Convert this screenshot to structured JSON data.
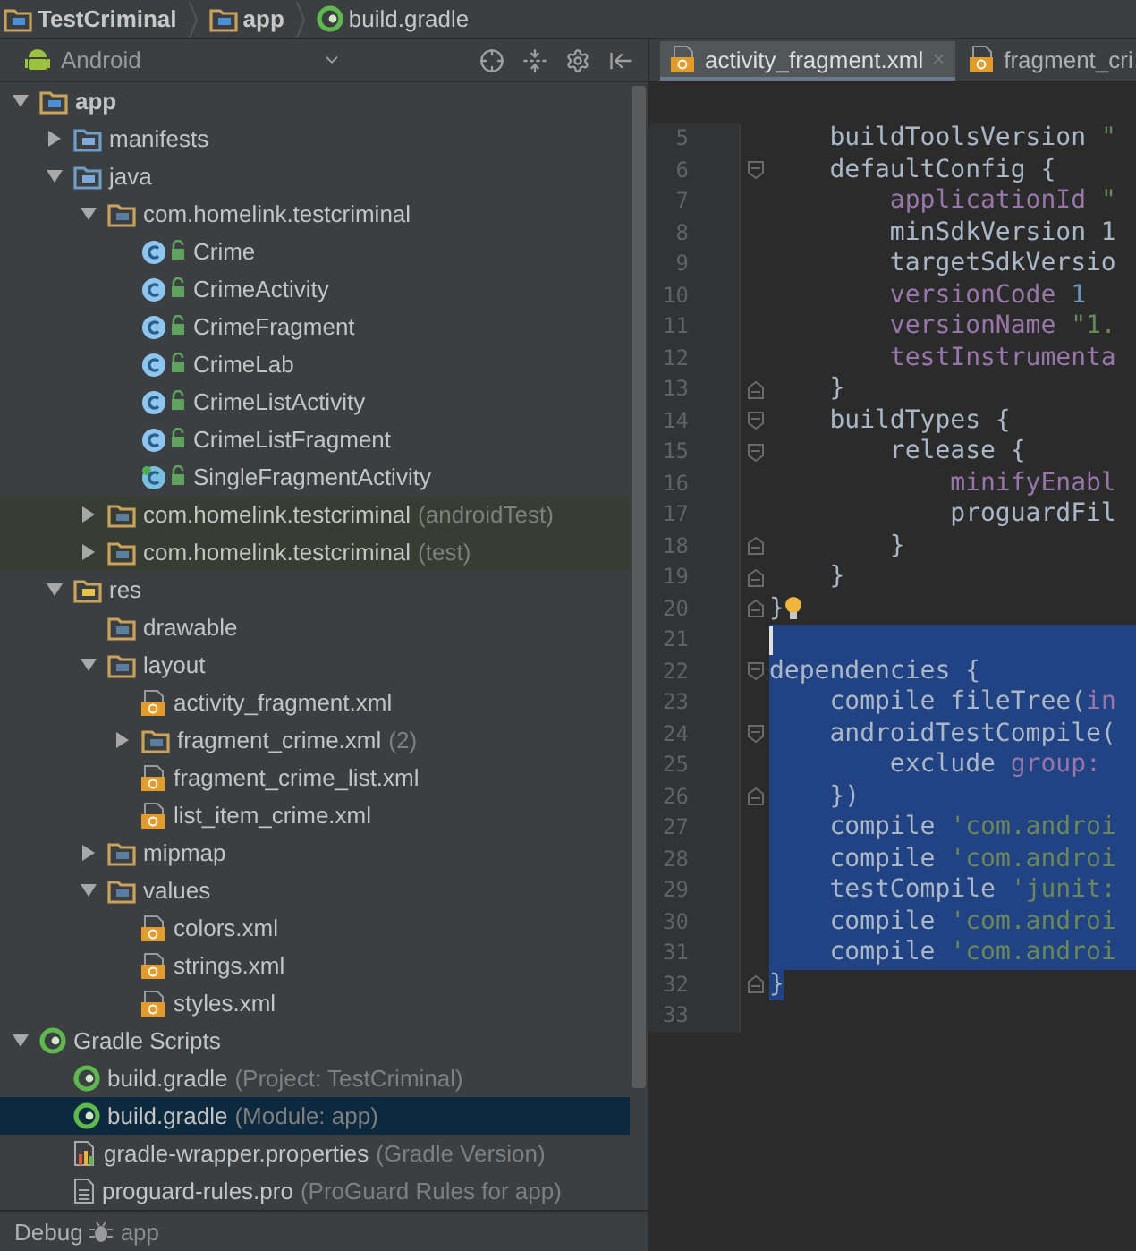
{
  "breadcrumb": [
    {
      "label": "TestCriminal",
      "kind": "project"
    },
    {
      "label": "app",
      "kind": "module"
    },
    {
      "label": "build.gradle",
      "kind": "gradle"
    }
  ],
  "project_panel": {
    "view": "Android"
  },
  "tree": {
    "items": [
      {
        "label": "app",
        "kind": "module",
        "expanded": true,
        "selected": false,
        "children": [
          {
            "label": "manifests",
            "kind": "folder",
            "expanded": false,
            "selected": false
          },
          {
            "label": "java",
            "kind": "folder",
            "expanded": true,
            "selected": false,
            "children": [
              {
                "label": "com.homelink.testcriminal",
                "kind": "package",
                "expanded": true,
                "selected": false,
                "children": [
                  {
                    "label": "Crime",
                    "kind": "class",
                    "selected": false
                  },
                  {
                    "label": "CrimeActivity",
                    "kind": "class",
                    "selected": false
                  },
                  {
                    "label": "CrimeFragment",
                    "kind": "class",
                    "selected": false
                  },
                  {
                    "label": "CrimeLab",
                    "kind": "class",
                    "selected": false
                  },
                  {
                    "label": "CrimeListActivity",
                    "kind": "class",
                    "selected": false
                  },
                  {
                    "label": "CrimeListFragment",
                    "kind": "class",
                    "selected": false
                  },
                  {
                    "label": "SingleFragmentActivity",
                    "kind": "abstract-class",
                    "selected": false
                  }
                ]
              },
              {
                "label": "com.homelink.testcriminal",
                "note": "(androidTest)",
                "kind": "package",
                "expanded": false,
                "test_scope": true,
                "selected": false
              },
              {
                "label": "com.homelink.testcriminal",
                "note": "(test)",
                "kind": "package",
                "expanded": false,
                "test_scope": true,
                "selected": false
              }
            ]
          },
          {
            "label": "res",
            "kind": "res-folder",
            "expanded": true,
            "selected": false,
            "children": [
              {
                "label": "drawable",
                "kind": "package",
                "selected": false
              },
              {
                "label": "layout",
                "kind": "package",
                "expanded": true,
                "selected": false,
                "children": [
                  {
                    "label": "activity_fragment.xml",
                    "kind": "xml",
                    "selected": false
                  },
                  {
                    "label": "fragment_crime.xml",
                    "note": "(2)",
                    "kind": "package",
                    "expanded": false,
                    "selected": false
                  },
                  {
                    "label": "fragment_crime_list.xml",
                    "kind": "xml",
                    "selected": false
                  },
                  {
                    "label": "list_item_crime.xml",
                    "kind": "xml",
                    "selected": false
                  }
                ]
              },
              {
                "label": "mipmap",
                "kind": "package",
                "expanded": false,
                "selected": false
              },
              {
                "label": "values",
                "kind": "package",
                "expanded": true,
                "selected": false,
                "children": [
                  {
                    "label": "colors.xml",
                    "kind": "xml",
                    "selected": false
                  },
                  {
                    "label": "strings.xml",
                    "kind": "xml",
                    "selected": false
                  },
                  {
                    "label": "styles.xml",
                    "kind": "xml",
                    "selected": false
                  }
                ]
              }
            ]
          }
        ]
      },
      {
        "label": "Gradle Scripts",
        "kind": "gradle",
        "expanded": true,
        "selected": false,
        "children": [
          {
            "label": "build.gradle",
            "note": "(Project: TestCriminal)",
            "kind": "gradle",
            "selected": false
          },
          {
            "label": "build.gradle",
            "note": "(Module: app)",
            "kind": "gradle",
            "selected": true
          },
          {
            "label": "gradle-wrapper.properties",
            "note": "(Gradle Version)",
            "kind": "properties",
            "selected": false
          },
          {
            "label": "proguard-rules.pro",
            "note": "(ProGuard Rules for app)",
            "kind": "text",
            "selected": false
          }
        ]
      }
    ]
  },
  "debug_bar": {
    "label": "Debug",
    "target": "app"
  },
  "editor_tabs": [
    {
      "label": "activity_fragment.xml",
      "close": "×",
      "selected": true
    },
    {
      "label": "fragment_cri",
      "selected": false
    }
  ],
  "code_lines": [
    {
      "number": "5",
      "selected": false,
      "segments": [
        {
          "text": "    buildToolsVersion ",
          "kind": "plain"
        },
        {
          "text": "\"",
          "kind": "string"
        }
      ]
    },
    {
      "number": "6",
      "selected": false,
      "fold_start": true,
      "segments": [
        {
          "text": "    defaultConfig {",
          "kind": "plain"
        }
      ]
    },
    {
      "number": "7",
      "selected": false,
      "segments": [
        {
          "text": "        applicationId ",
          "kind": "field"
        },
        {
          "text": "\"",
          "kind": "string"
        }
      ]
    },
    {
      "number": "8",
      "selected": false,
      "segments": [
        {
          "text": "        minSdkVersion 1",
          "kind": "plain"
        }
      ]
    },
    {
      "number": "9",
      "selected": false,
      "segments": [
        {
          "text": "        targetSdkVersio",
          "kind": "plain"
        }
      ]
    },
    {
      "number": "10",
      "selected": false,
      "segments": [
        {
          "text": "        versionCode ",
          "kind": "field"
        },
        {
          "text": "1",
          "kind": "number"
        }
      ]
    },
    {
      "number": "11",
      "selected": false,
      "segments": [
        {
          "text": "        versionName ",
          "kind": "field"
        },
        {
          "text": "\"1.",
          "kind": "string"
        }
      ]
    },
    {
      "number": "12",
      "selected": false,
      "segments": [
        {
          "text": "        testInstrumenta",
          "kind": "field"
        }
      ]
    },
    {
      "number": "13",
      "selected": false,
      "fold_end": true,
      "segments": [
        {
          "text": "    }",
          "kind": "plain"
        }
      ]
    },
    {
      "number": "14",
      "selected": false,
      "fold_start": true,
      "segments": [
        {
          "text": "    buildTypes {",
          "kind": "plain"
        }
      ]
    },
    {
      "number": "15",
      "selected": false,
      "fold_start": true,
      "segments": [
        {
          "text": "        release {",
          "kind": "plain"
        }
      ]
    },
    {
      "number": "16",
      "selected": false,
      "segments": [
        {
          "text": "            minifyEnabl",
          "kind": "field"
        }
      ]
    },
    {
      "number": "17",
      "selected": false,
      "segments": [
        {
          "text": "            proguardFil",
          "kind": "plain"
        }
      ]
    },
    {
      "number": "18",
      "selected": false,
      "fold_end": true,
      "segments": [
        {
          "text": "        }",
          "kind": "plain"
        }
      ]
    },
    {
      "number": "19",
      "selected": false,
      "fold_end": true,
      "segments": [
        {
          "text": "    }",
          "kind": "plain"
        }
      ]
    },
    {
      "number": "20",
      "selected": false,
      "fold_end": true,
      "bulb": true,
      "segments": [
        {
          "text": "}",
          "kind": "plain"
        }
      ]
    },
    {
      "number": "21",
      "selected": true,
      "cursor": true
    },
    {
      "number": "22",
      "selected": true,
      "fold_start": true,
      "segments": [
        {
          "text": "dependencies {",
          "kind": "plain"
        }
      ]
    },
    {
      "number": "23",
      "selected": true,
      "segments": [
        {
          "text": "    compile fileTree(",
          "kind": "plain"
        },
        {
          "text": "in",
          "kind": "field"
        }
      ]
    },
    {
      "number": "24",
      "selected": true,
      "fold_start": true,
      "segments": [
        {
          "text": "    androidTestCompile(",
          "kind": "plain"
        }
      ]
    },
    {
      "number": "25",
      "selected": true,
      "segments": [
        {
          "text": "        exclude ",
          "kind": "plain"
        },
        {
          "text": "group:",
          "kind": "field"
        }
      ]
    },
    {
      "number": "26",
      "selected": true,
      "fold_end": true,
      "segments": [
        {
          "text": "    })",
          "kind": "plain"
        }
      ]
    },
    {
      "number": "27",
      "selected": true,
      "segments": [
        {
          "text": "    compile ",
          "kind": "plain"
        },
        {
          "text": "'com.androi",
          "kind": "string"
        }
      ]
    },
    {
      "number": "28",
      "selected": true,
      "segments": [
        {
          "text": "    compile ",
          "kind": "plain"
        },
        {
          "text": "'com.androi",
          "kind": "string"
        }
      ]
    },
    {
      "number": "29",
      "selected": true,
      "segments": [
        {
          "text": "    testCompile ",
          "kind": "plain"
        },
        {
          "text": "'junit:",
          "kind": "string"
        }
      ]
    },
    {
      "number": "30",
      "selected": true,
      "segments": [
        {
          "text": "    compile ",
          "kind": "plain"
        },
        {
          "text": "'com.androi",
          "kind": "string"
        }
      ]
    },
    {
      "number": "31",
      "selected": true,
      "segments": [
        {
          "text": "    compile ",
          "kind": "plain"
        },
        {
          "text": "'com.androi",
          "kind": "string"
        }
      ]
    },
    {
      "number": "32",
      "selected": false,
      "fold_end": true,
      "segments": [
        {
          "text": "}",
          "kind": "matched-brace"
        }
      ]
    },
    {
      "number": "33",
      "selected": false
    }
  ]
}
